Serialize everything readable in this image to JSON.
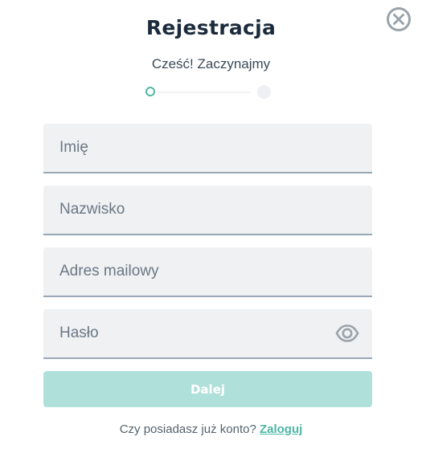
{
  "header": {
    "title": "Rejestracja",
    "subtitle": "Cześć! Zaczynajmy",
    "close_icon": "close-circle-icon"
  },
  "stepper": {
    "current_step": 1,
    "total_steps": 2
  },
  "form": {
    "first_name": {
      "placeholder": "Imię",
      "value": ""
    },
    "last_name": {
      "placeholder": "Nazwisko",
      "value": ""
    },
    "email": {
      "placeholder": "Adres mailowy",
      "value": ""
    },
    "password": {
      "placeholder": "Hasło",
      "value": "",
      "toggle_icon": "eye-icon"
    },
    "submit_label": "Dalej"
  },
  "footer": {
    "question": "Czy posiadasz już konto?",
    "login_link": "Zaloguj"
  },
  "colors": {
    "accent": "#4fb6a5",
    "button_disabled": "#b0e0da",
    "title": "#1c2b3c",
    "field_bg": "#eff1f3"
  }
}
